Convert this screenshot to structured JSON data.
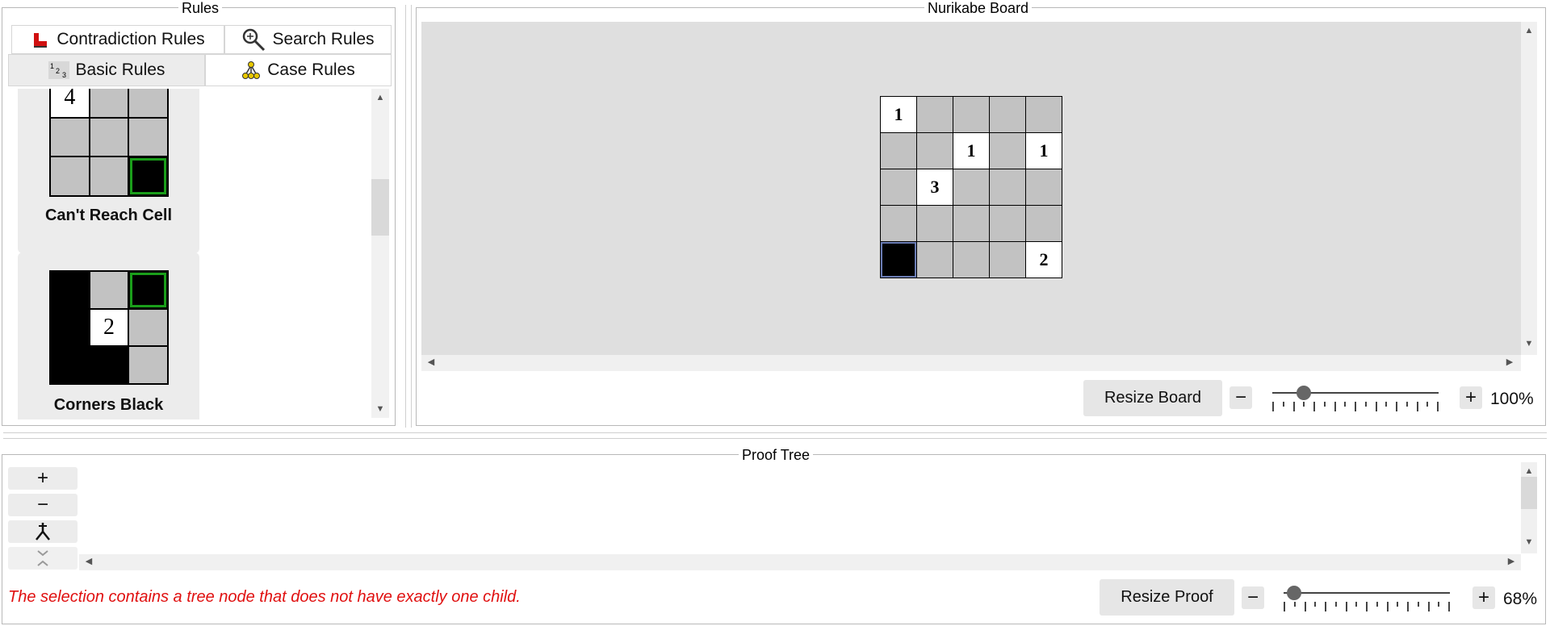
{
  "rules_panel": {
    "title": "Rules",
    "tabs": {
      "contradiction": "Contradiction Rules",
      "search": "Search Rules",
      "basic": "Basic Rules",
      "case": "Case Rules"
    },
    "cards": [
      {
        "title": "Can't Reach Cell",
        "cells": [
          "4",
          "",
          "",
          "",
          "",
          "",
          "",
          "",
          ""
        ]
      },
      {
        "title": "Corners Black",
        "cells": [
          "",
          "",
          "",
          "",
          "2",
          "",
          "",
          "",
          ""
        ]
      }
    ]
  },
  "board_panel": {
    "title": "Nurikabe Board",
    "cells": [
      "1",
      "",
      "",
      "",
      "",
      "",
      "",
      "1",
      "",
      "1",
      "",
      "3",
      "",
      "",
      "",
      "",
      "",
      "",
      "",
      "",
      "",
      "",
      "",
      "",
      "2"
    ],
    "resize_label": "Resize Board",
    "minus": "−",
    "plus": "+",
    "zoom": "100%"
  },
  "proof_panel": {
    "title": "Proof Tree",
    "tools": {
      "add": "+",
      "remove": "−",
      "merge": "⅄"
    },
    "status": "The selection contains a tree node that does not have exactly one child.",
    "resize_label": "Resize Proof",
    "minus": "−",
    "plus": "+",
    "zoom": "68%"
  },
  "colors": {
    "status": "#e01010",
    "highlight": "#1a9e1a",
    "selection": "#6b7db5"
  },
  "icons": [
    "contradiction-icon",
    "search-icon",
    "basic-rules-icon",
    "case-rules-icon",
    "merge-icon",
    "collapse-icon"
  ]
}
